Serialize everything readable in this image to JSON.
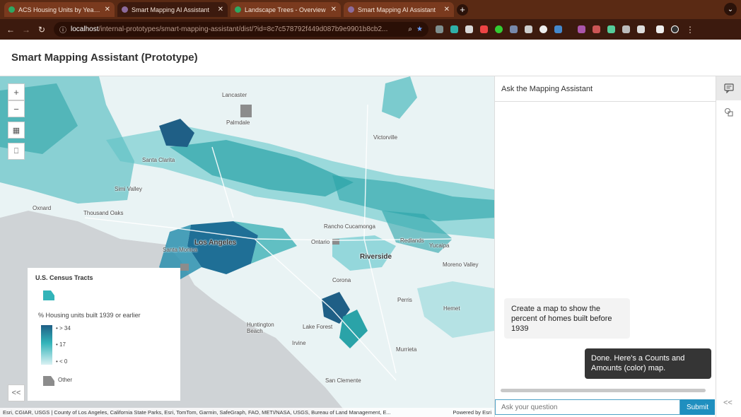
{
  "browser": {
    "tabs": [
      {
        "title": "ACS Housing Units by Year Built",
        "active": false,
        "color": "#2ea862"
      },
      {
        "title": "Smart Mapping AI Assistant",
        "active": true,
        "color": "#8c6b9c"
      },
      {
        "title": "Landscape Trees - Overview",
        "active": false,
        "color": "#2ea862"
      },
      {
        "title": "Smart Mapping AI Assistant",
        "active": false,
        "color": "#8c6b9c"
      }
    ],
    "url_host": "localhost",
    "url_path": "/internal-prototypes/smart-mapping-assistant/dist/?id=8c7c578792f449d087b9e9901b8cb2..."
  },
  "app": {
    "title": "Smart Mapping Assistant (Prototype)"
  },
  "map": {
    "zoom_in": "+",
    "zoom_out": "−",
    "places": [
      {
        "name": "Lancaster"
      },
      {
        "name": "Palmdale"
      },
      {
        "name": "Victorville"
      },
      {
        "name": "Santa Clarita"
      },
      {
        "name": "Simi Valley"
      },
      {
        "name": "Thousand Oaks"
      },
      {
        "name": "Oxnard"
      },
      {
        "name": "Los Angeles",
        "big": true
      },
      {
        "name": "Santa Monica"
      },
      {
        "name": "Rancho Cucamonga"
      },
      {
        "name": "Ontario"
      },
      {
        "name": "Riverside",
        "big": true
      },
      {
        "name": "Redlands"
      },
      {
        "name": "Yucaipa"
      },
      {
        "name": "Moreno Valley"
      },
      {
        "name": "Corona"
      },
      {
        "name": "Perris"
      },
      {
        "name": "Hemet"
      },
      {
        "name": "Huntington Beach"
      },
      {
        "name": "Lake Forest"
      },
      {
        "name": "Irvine"
      },
      {
        "name": "Murrieta"
      },
      {
        "name": "San Clemente"
      }
    ],
    "attribution": "Esri, CGIAR, USGS | County of Los Angeles, California State Parks, Esri, TomTom, Garmin, SafeGraph, FAO, METI/NASA, USGS, Bureau of Land Management, E...",
    "powered_by": "Powered by Esri",
    "collapse_label": "<<"
  },
  "legend": {
    "layer_title": "U.S. Census Tracts",
    "field_label": "% Housing units built 1939 or earlier",
    "ramp_high": "> 34",
    "ramp_mid": "17",
    "ramp_low": "< 0",
    "other_label": "Other",
    "colors": {
      "high": "#1f5f86",
      "mid": "#32b4b9",
      "low": "#d9f1f3",
      "other": "#8c8c8c"
    }
  },
  "assistant": {
    "header": "Ask the Mapping Assistant",
    "messages": [
      {
        "role": "user",
        "text": "Create a map to show the percent of homes built before 1939"
      },
      {
        "role": "assistant",
        "text": "Done. Here's a Counts and Amounts (color) map."
      }
    ],
    "input_placeholder": "Ask your question",
    "submit_label": "Submit",
    "collapse_label": "<<"
  }
}
